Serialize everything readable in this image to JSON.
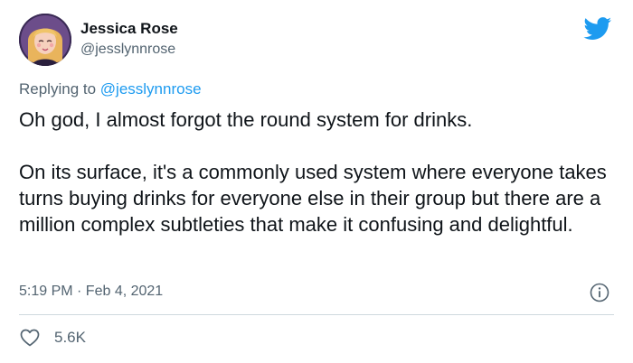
{
  "author": {
    "name": "Jessica Rose",
    "handle": "@jesslynnrose"
  },
  "reply": {
    "prefix": "Replying to ",
    "mention": "@jesslynnrose"
  },
  "tweet": {
    "paragraphs": [
      "Oh god, I almost forgot the round system for drinks.",
      "On its surface, it's a commonly used system where everyone takes turns buying drinks for everyone else in their group but there are a million complex subtleties that make it confusing and delightful."
    ]
  },
  "meta": {
    "timestamp": "5:19 PM · Feb 4, 2021"
  },
  "actions": {
    "likes": "5.6K"
  },
  "icons": {
    "brand": "twitter-bird-icon",
    "info": "info-icon",
    "like": "heart-icon"
  },
  "colors": {
    "brand_blue": "#1d9bf0",
    "secondary_text": "#536471",
    "primary_text": "#0f1419",
    "divider": "#cfd9de"
  }
}
